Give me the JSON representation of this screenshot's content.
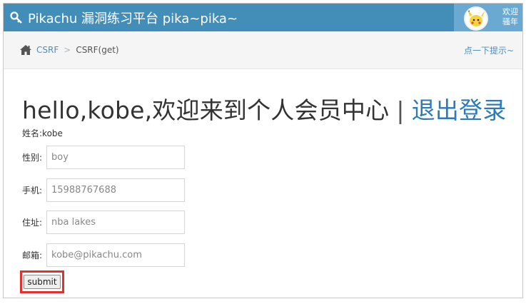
{
  "navbar": {
    "brand": "Pikachu 漏洞练习平台 pika~pika~",
    "welcome_line1": "欢迎",
    "welcome_line2": "骚年"
  },
  "breadcrumb": {
    "items": [
      {
        "label": "CSRF"
      },
      {
        "label": "CSRF(get)"
      }
    ],
    "hint": "点一下提示~"
  },
  "main": {
    "greeting": "hello,kobe,欢迎来到个人会员中心",
    "divider": "|",
    "logout_label": "退出登录",
    "name_line": "姓名:kobe",
    "fields": [
      {
        "label": "性别:",
        "value": "boy"
      },
      {
        "label": "手机:",
        "value": "15988767688"
      },
      {
        "label": "住址:",
        "value": "nba lakes"
      },
      {
        "label": "邮箱:",
        "value": "kobe@pikachu.com"
      }
    ],
    "submit_label": "submit"
  },
  "colors": {
    "navbar_bg": "#438eb9",
    "link": "#4c8fbd",
    "highlight_border": "#e03030"
  }
}
